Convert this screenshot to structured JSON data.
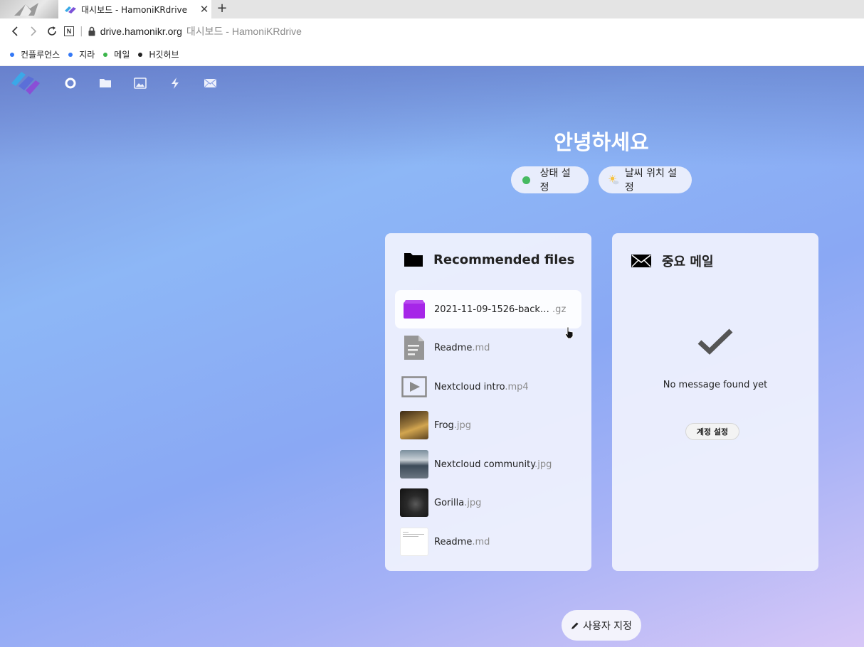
{
  "browser": {
    "tab_title": "대시보드 - HamoniKRdrive",
    "tab_close": "✕",
    "new_tab": "+",
    "url_host": "drive.hamonikr.org",
    "url_page_title": "대시보드 - HamoniKRdrive",
    "n_icon_text": "N",
    "separator": "|",
    "bookmarks": [
      {
        "label": "컨플루언스",
        "color": "#3478f6"
      },
      {
        "label": "지라",
        "color": "#3478f6"
      },
      {
        "label": "메일",
        "color": "#3bb54a"
      },
      {
        "label": "H깃허브",
        "color": "#222222"
      }
    ]
  },
  "app": {
    "nav_icons": [
      "logo-icon",
      "dashboard-icon",
      "files-icon",
      "photos-icon",
      "activity-icon",
      "mail-icon"
    ],
    "greeting": "안녕하세요",
    "status_button": "상태 설정",
    "status_color": "#46ba61",
    "weather_button": "날씨 위치 설정",
    "files_widget": {
      "title": "Recommended files",
      "items": [
        {
          "name": "2021-11-09-1526-back…",
          "ext": " .gz",
          "icon": "archive-icon"
        },
        {
          "name": "Readme",
          "ext": ".md",
          "icon": "text-file-icon"
        },
        {
          "name": "Nextcloud intro",
          "ext": ".mp4",
          "icon": "video-file-icon"
        },
        {
          "name": "Frog",
          "ext": ".jpg",
          "icon": "image-thumbnail"
        },
        {
          "name": "Nextcloud community",
          "ext": ".jpg",
          "icon": "image-thumbnail"
        },
        {
          "name": "Gorilla",
          "ext": ".jpg",
          "icon": "image-thumbnail"
        },
        {
          "name": "Readme",
          "ext": ".md",
          "icon": "document-thumbnail"
        }
      ]
    },
    "mail_widget": {
      "title": "중요 메일",
      "empty_text": "No message found yet",
      "account_button": "계정 설정"
    },
    "customize_button": "사용자 지정",
    "colors": {
      "archive": "#a626e8",
      "accent": "#0082c9"
    }
  }
}
